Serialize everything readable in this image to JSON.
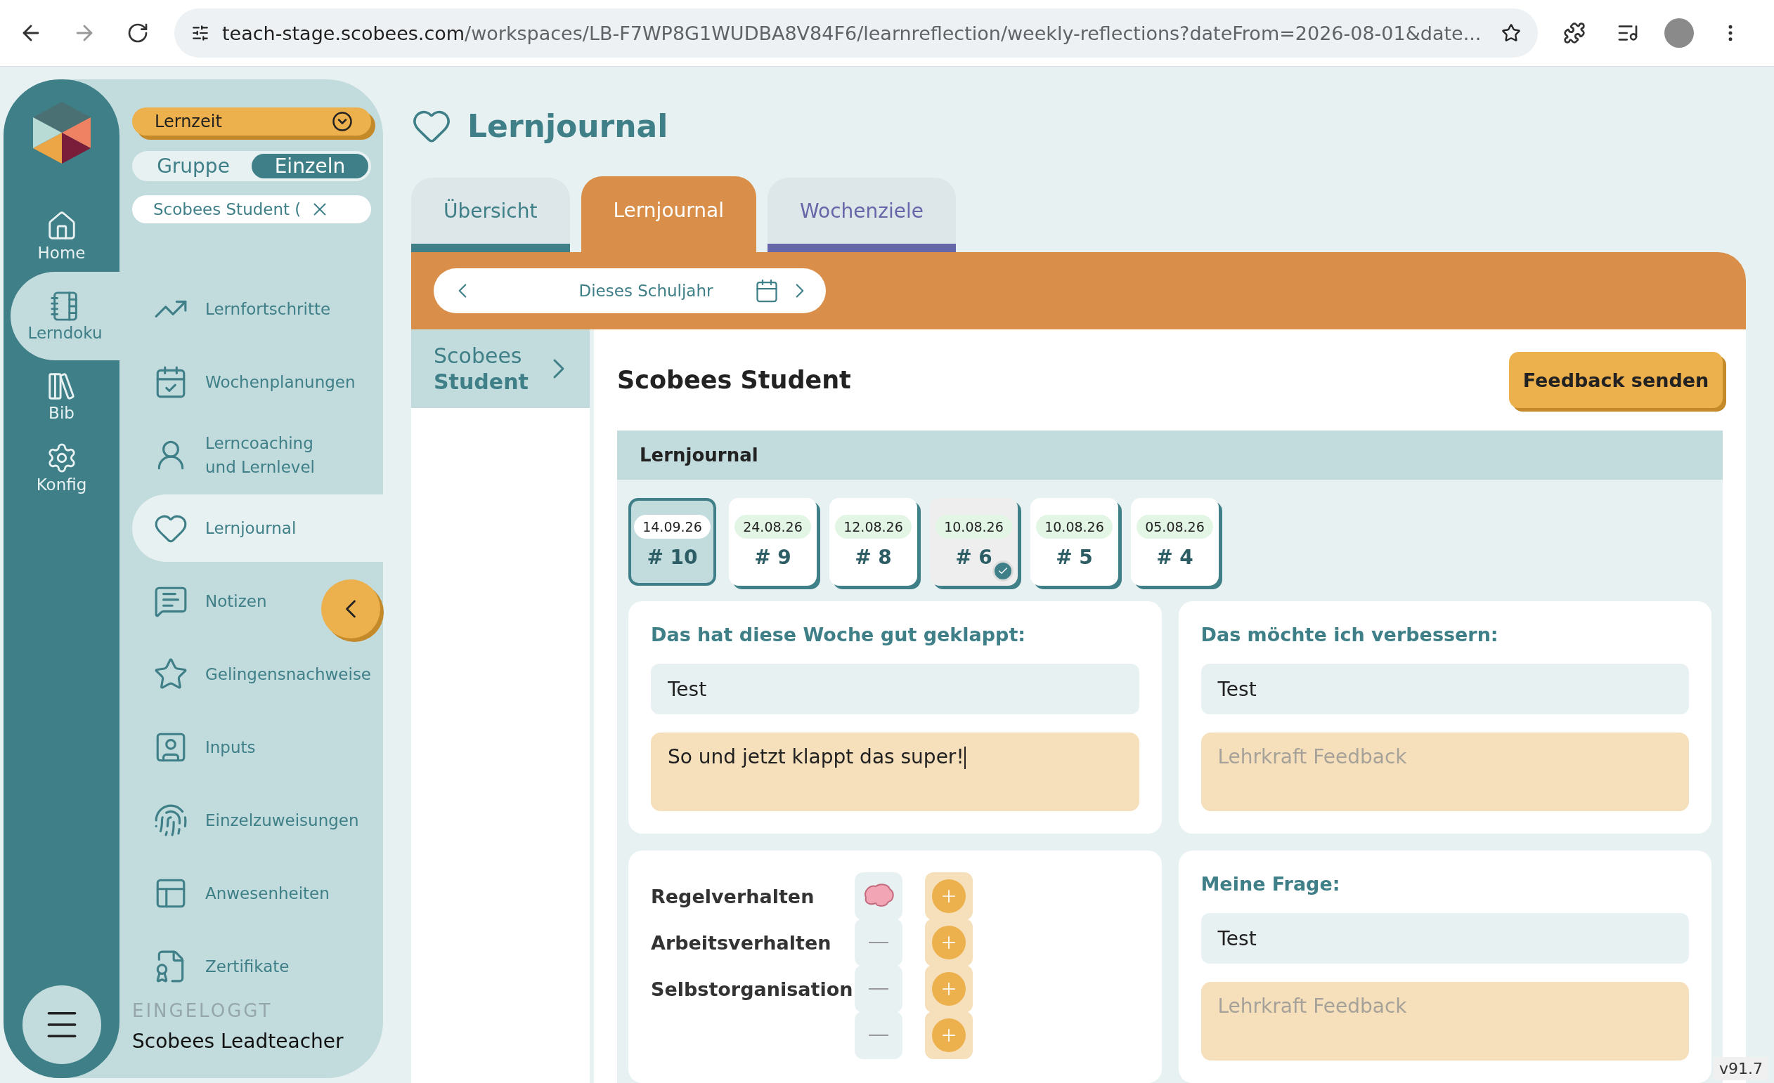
{
  "browser": {
    "url_host": "teach-stage.scobees.com",
    "url_path": "/workspaces/LB-F7WP8G1WUDBA8V84F6/learnreflection/weekly-reflections?dateFrom=2026-08-01&date..."
  },
  "rail": {
    "items": [
      {
        "label": "Home",
        "selected": false
      },
      {
        "label": "Lerndoku",
        "selected": true
      },
      {
        "label": "Bib",
        "selected": false
      },
      {
        "label": "Konfig",
        "selected": false
      }
    ]
  },
  "sidebar": {
    "mode": "Lernzeit",
    "toggle": [
      {
        "label": "Gruppe",
        "selected": false
      },
      {
        "label": "Einzeln",
        "selected": true
      }
    ],
    "student_chip": "Scobees Student (",
    "nav": [
      {
        "label": "Lernfortschritte",
        "selected": false
      },
      {
        "label": "Wochenplanungen",
        "selected": false
      },
      {
        "label": "Lerncoaching\nund Lernlevel",
        "selected": false
      },
      {
        "label": "Lernjournal",
        "selected": true
      },
      {
        "label": "Notizen",
        "selected": false
      },
      {
        "label": "Gelingensnachweise",
        "selected": false
      },
      {
        "label": "Inputs",
        "selected": false
      },
      {
        "label": "Einzelzuweisungen",
        "selected": false
      },
      {
        "label": "Anwesenheiten",
        "selected": false
      },
      {
        "label": "Zertifikate",
        "selected": false
      }
    ],
    "logged_in_label": "EINGELOGGT",
    "user": "Scobees Leadteacher"
  },
  "page_title": "Lernjournal",
  "tabs": [
    {
      "label": "Übersicht",
      "selected": false,
      "color": "#3f7f88"
    },
    {
      "label": "Lernjournal",
      "selected": true,
      "color": "#d98f4a"
    },
    {
      "label": "Wochenziele",
      "selected": false,
      "color": "#6667a8"
    }
  ],
  "period": "Dieses Schuljahr",
  "students": [
    {
      "name": "Scobees **Student**",
      "selected": true
    }
  ],
  "content": {
    "heading": "Scobees Student",
    "feedback_button": "Feedback senden",
    "section_title": "Lernjournal",
    "entries": [
      {
        "date": "14.09.26",
        "number": "# 10",
        "selected": true,
        "done": false
      },
      {
        "date": "24.08.26",
        "number": "# 9",
        "selected": false,
        "done": false
      },
      {
        "date": "12.08.26",
        "number": "# 8",
        "selected": false,
        "done": false
      },
      {
        "date": "10.08.26",
        "number": "# 6",
        "selected": false,
        "done": true
      },
      {
        "date": "10.08.26",
        "number": "# 5",
        "selected": false,
        "done": false
      },
      {
        "date": "05.08.26",
        "number": "# 4",
        "selected": false,
        "done": false
      }
    ],
    "reflections": [
      {
        "title": "Das hat diese Woche gut geklappt:",
        "answer": "Test",
        "feedback": "So und jetzt klappt das super!"
      },
      {
        "title": "Das möchte ich verbessern:",
        "answer": "Test",
        "feedback_placeholder": "Lehrkraft Feedback"
      }
    ],
    "behaviours": [
      {
        "label": "Regelverhalten",
        "rated": true
      },
      {
        "label": "Arbeitsverhalten",
        "rated": false
      },
      {
        "label": "Selbstorganisation",
        "rated": false
      },
      {
        "rated": false
      }
    ],
    "question": {
      "title": "Meine Frage:",
      "answer": "Test",
      "feedback_placeholder": "Lehrkraft Feedback"
    }
  },
  "version": "v91.7"
}
